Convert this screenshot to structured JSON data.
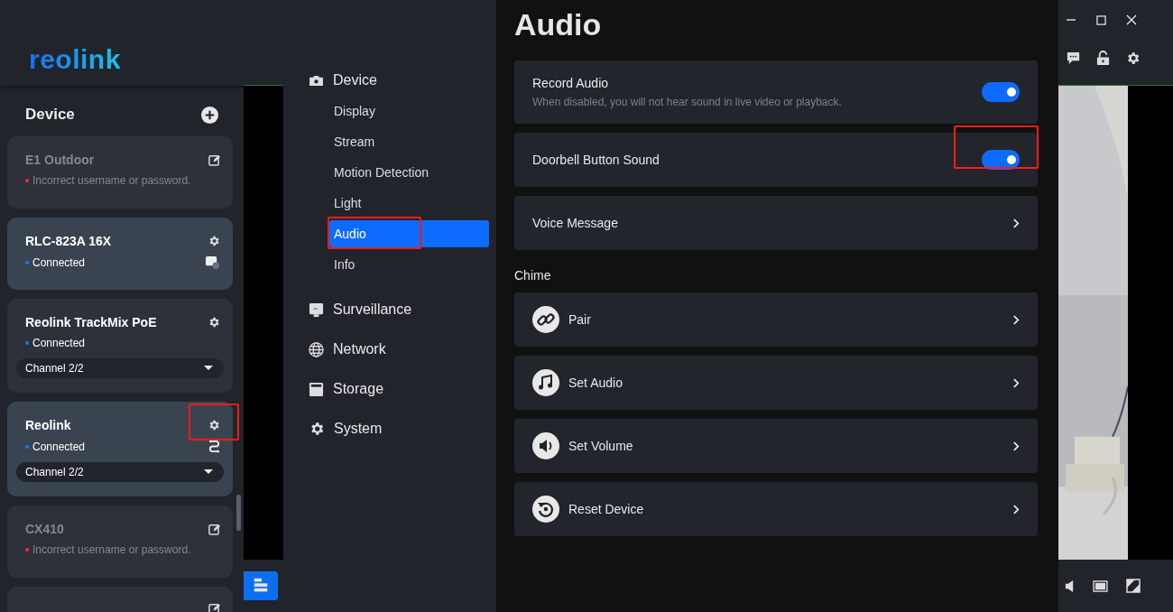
{
  "logo_text": "reolink",
  "sidebar": {
    "title": "Device",
    "devices": [
      {
        "name": "E1 Outdoor",
        "status": "Incorrect username or password.",
        "kind": "error",
        "selected": false
      },
      {
        "name": "RLC-823A 16X",
        "status": "Connected",
        "kind": "connected",
        "selected": true
      },
      {
        "name": "Reolink TrackMix PoE",
        "status": "Connected",
        "kind": "connected",
        "selected": false,
        "channel": "Channel 2/2"
      },
      {
        "name": "Reolink",
        "status": "Connected",
        "kind": "connected",
        "selected": true,
        "channel": "Channel 2/2",
        "highlighted": true
      },
      {
        "name": "CX410",
        "status": "Incorrect username or password.",
        "kind": "error",
        "selected": false
      },
      {
        "kind": "error",
        "selected": false
      }
    ]
  },
  "settings_nav": [
    {
      "label": "Device",
      "children": [
        {
          "label": "Display",
          "selected": false,
          "highlighted": false
        },
        {
          "label": "Stream",
          "selected": false,
          "highlighted": false
        },
        {
          "label": "Motion Detection",
          "selected": false,
          "highlighted": false
        },
        {
          "label": "Light",
          "selected": false,
          "highlighted": false
        },
        {
          "label": "Audio",
          "selected": true,
          "highlighted": true
        },
        {
          "label": "Info",
          "selected": false,
          "highlighted": false
        }
      ]
    },
    {
      "label": "Surveillance"
    },
    {
      "label": "Network"
    },
    {
      "label": "Storage"
    },
    {
      "label": "System"
    }
  ],
  "page": {
    "title": "Audio",
    "rows": [
      {
        "kind": "toggle",
        "label": "Record Audio",
        "description": "When disabled, you will not hear sound in live video or playback.",
        "on": true,
        "highlighted": false
      },
      {
        "kind": "toggle",
        "label": "Doorbell Button Sound",
        "on": true,
        "highlighted": true
      },
      {
        "kind": "link",
        "label": "Voice Message"
      }
    ],
    "sections": [
      {
        "title": "Chime",
        "rows": [
          {
            "kind": "link",
            "label": "Pair"
          },
          {
            "kind": "link",
            "label": "Set Audio"
          },
          {
            "kind": "link",
            "label": "Set Volume"
          },
          {
            "kind": "link",
            "label": "Reset Device"
          }
        ]
      }
    ]
  }
}
